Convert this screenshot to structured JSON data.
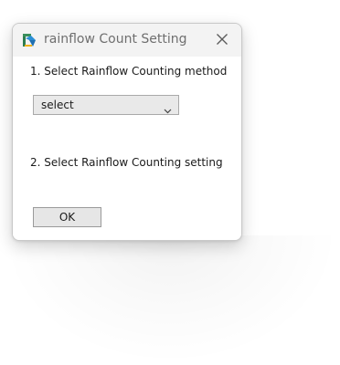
{
  "window": {
    "title": "rainflow Count Setting",
    "icon": "app-icon",
    "close_icon": "close-icon"
  },
  "steps": {
    "method_label": "1. Select Rainflow Counting method",
    "setting_label": "2. Select Rainflow Counting setting"
  },
  "method_select": {
    "selected_value": "select",
    "chevron_icon": "chevron-down-icon"
  },
  "buttons": {
    "ok_label": "OK"
  },
  "colors": {
    "window_background": "#f3f3f3",
    "content_background": "#ffffff",
    "title_text": "#6f6f6f",
    "control_background": "#e9e9e9",
    "control_border": "#a9a9a9"
  }
}
